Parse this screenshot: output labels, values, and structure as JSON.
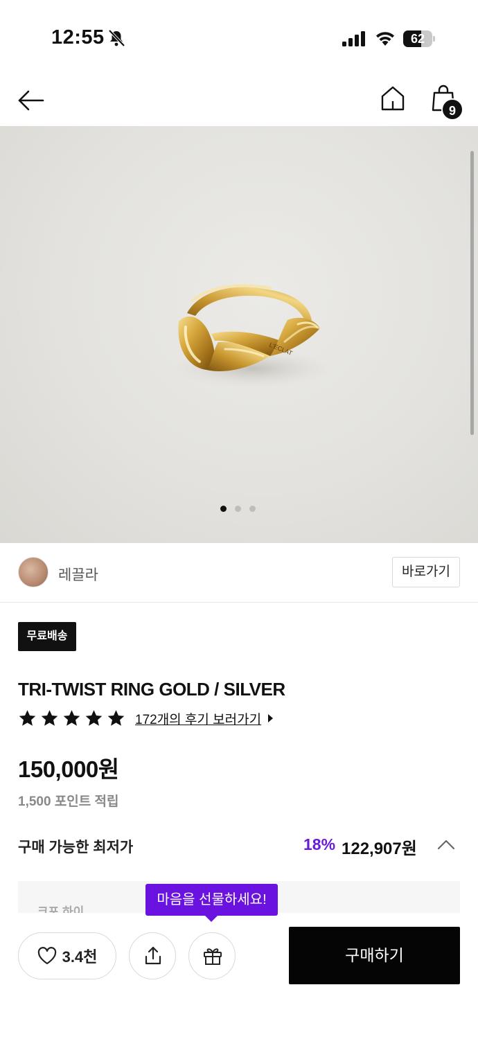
{
  "status_bar": {
    "time": "12:55",
    "battery_level": "62",
    "battery_fraction": 0.62
  },
  "nav": {
    "cart_count": "9"
  },
  "gallery": {
    "total_images": 3,
    "active_index": 0
  },
  "brand": {
    "name": "레끌라",
    "shortcut_label": "바로가기"
  },
  "product": {
    "shipping_badge": "무료배송",
    "title": "TRI-TWIST RING GOLD / SILVER",
    "rating_stars": 5,
    "review_link": "172개의 후기 보러가기",
    "price": "150,000원",
    "points": "1,500 포인트 적립",
    "lowest_label": "구매 가능한 최저가",
    "lowest_discount": "18%",
    "lowest_price": "122,907원",
    "coupon_text": "크포 하이"
  },
  "bottom_bar": {
    "like_count": "3.4천",
    "gift_tooltip": "마음을 선물하세요!",
    "buy_label": "구매하기"
  },
  "colors": {
    "accent_purple": "#6a12e0",
    "discount_purple": "#6a1bd6",
    "primary_black": "#050505"
  }
}
